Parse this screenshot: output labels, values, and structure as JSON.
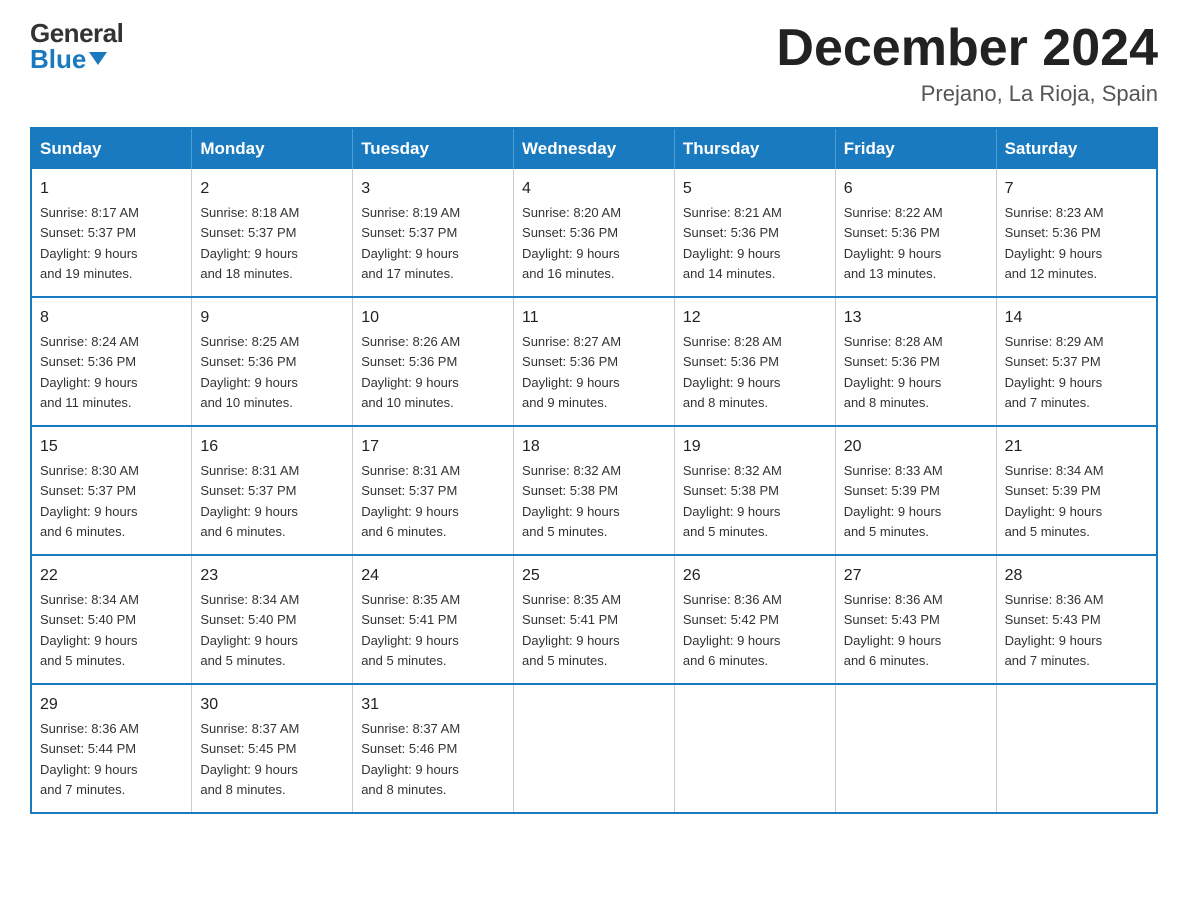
{
  "header": {
    "logo_general": "General",
    "logo_blue": "Blue",
    "month_title": "December 2024",
    "location": "Prejano, La Rioja, Spain"
  },
  "days_of_week": [
    "Sunday",
    "Monday",
    "Tuesday",
    "Wednesday",
    "Thursday",
    "Friday",
    "Saturday"
  ],
  "weeks": [
    [
      {
        "day": "1",
        "sunrise": "8:17 AM",
        "sunset": "5:37 PM",
        "daylight": "9 hours and 19 minutes."
      },
      {
        "day": "2",
        "sunrise": "8:18 AM",
        "sunset": "5:37 PM",
        "daylight": "9 hours and 18 minutes."
      },
      {
        "day": "3",
        "sunrise": "8:19 AM",
        "sunset": "5:37 PM",
        "daylight": "9 hours and 17 minutes."
      },
      {
        "day": "4",
        "sunrise": "8:20 AM",
        "sunset": "5:36 PM",
        "daylight": "9 hours and 16 minutes."
      },
      {
        "day": "5",
        "sunrise": "8:21 AM",
        "sunset": "5:36 PM",
        "daylight": "9 hours and 14 minutes."
      },
      {
        "day": "6",
        "sunrise": "8:22 AM",
        "sunset": "5:36 PM",
        "daylight": "9 hours and 13 minutes."
      },
      {
        "day": "7",
        "sunrise": "8:23 AM",
        "sunset": "5:36 PM",
        "daylight": "9 hours and 12 minutes."
      }
    ],
    [
      {
        "day": "8",
        "sunrise": "8:24 AM",
        "sunset": "5:36 PM",
        "daylight": "9 hours and 11 minutes."
      },
      {
        "day": "9",
        "sunrise": "8:25 AM",
        "sunset": "5:36 PM",
        "daylight": "9 hours and 10 minutes."
      },
      {
        "day": "10",
        "sunrise": "8:26 AM",
        "sunset": "5:36 PM",
        "daylight": "9 hours and 10 minutes."
      },
      {
        "day": "11",
        "sunrise": "8:27 AM",
        "sunset": "5:36 PM",
        "daylight": "9 hours and 9 minutes."
      },
      {
        "day": "12",
        "sunrise": "8:28 AM",
        "sunset": "5:36 PM",
        "daylight": "9 hours and 8 minutes."
      },
      {
        "day": "13",
        "sunrise": "8:28 AM",
        "sunset": "5:36 PM",
        "daylight": "9 hours and 8 minutes."
      },
      {
        "day": "14",
        "sunrise": "8:29 AM",
        "sunset": "5:37 PM",
        "daylight": "9 hours and 7 minutes."
      }
    ],
    [
      {
        "day": "15",
        "sunrise": "8:30 AM",
        "sunset": "5:37 PM",
        "daylight": "9 hours and 6 minutes."
      },
      {
        "day": "16",
        "sunrise": "8:31 AM",
        "sunset": "5:37 PM",
        "daylight": "9 hours and 6 minutes."
      },
      {
        "day": "17",
        "sunrise": "8:31 AM",
        "sunset": "5:37 PM",
        "daylight": "9 hours and 6 minutes."
      },
      {
        "day": "18",
        "sunrise": "8:32 AM",
        "sunset": "5:38 PM",
        "daylight": "9 hours and 5 minutes."
      },
      {
        "day": "19",
        "sunrise": "8:32 AM",
        "sunset": "5:38 PM",
        "daylight": "9 hours and 5 minutes."
      },
      {
        "day": "20",
        "sunrise": "8:33 AM",
        "sunset": "5:39 PM",
        "daylight": "9 hours and 5 minutes."
      },
      {
        "day": "21",
        "sunrise": "8:34 AM",
        "sunset": "5:39 PM",
        "daylight": "9 hours and 5 minutes."
      }
    ],
    [
      {
        "day": "22",
        "sunrise": "8:34 AM",
        "sunset": "5:40 PM",
        "daylight": "9 hours and 5 minutes."
      },
      {
        "day": "23",
        "sunrise": "8:34 AM",
        "sunset": "5:40 PM",
        "daylight": "9 hours and 5 minutes."
      },
      {
        "day": "24",
        "sunrise": "8:35 AM",
        "sunset": "5:41 PM",
        "daylight": "9 hours and 5 minutes."
      },
      {
        "day": "25",
        "sunrise": "8:35 AM",
        "sunset": "5:41 PM",
        "daylight": "9 hours and 5 minutes."
      },
      {
        "day": "26",
        "sunrise": "8:36 AM",
        "sunset": "5:42 PM",
        "daylight": "9 hours and 6 minutes."
      },
      {
        "day": "27",
        "sunrise": "8:36 AM",
        "sunset": "5:43 PM",
        "daylight": "9 hours and 6 minutes."
      },
      {
        "day": "28",
        "sunrise": "8:36 AM",
        "sunset": "5:43 PM",
        "daylight": "9 hours and 7 minutes."
      }
    ],
    [
      {
        "day": "29",
        "sunrise": "8:36 AM",
        "sunset": "5:44 PM",
        "daylight": "9 hours and 7 minutes."
      },
      {
        "day": "30",
        "sunrise": "8:37 AM",
        "sunset": "5:45 PM",
        "daylight": "9 hours and 8 minutes."
      },
      {
        "day": "31",
        "sunrise": "8:37 AM",
        "sunset": "5:46 PM",
        "daylight": "9 hours and 8 minutes."
      },
      null,
      null,
      null,
      null
    ]
  ],
  "labels": {
    "sunrise": "Sunrise:",
    "sunset": "Sunset:",
    "daylight": "Daylight:"
  }
}
